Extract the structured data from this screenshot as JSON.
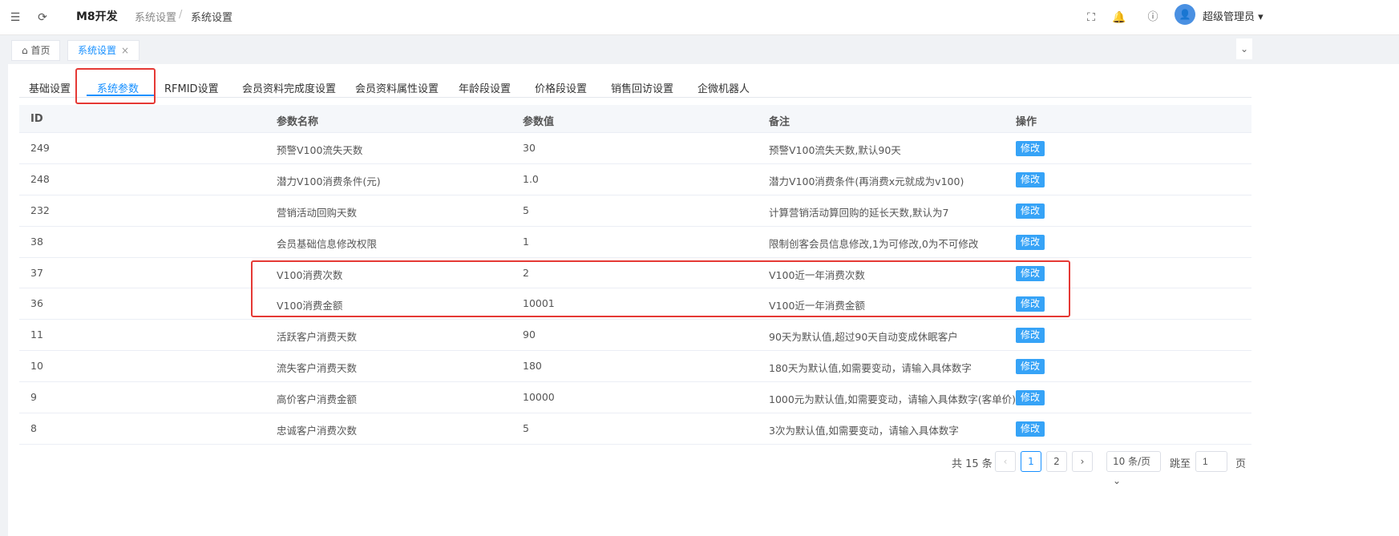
{
  "header": {
    "app_title": "M8开发",
    "breadcrumb": [
      "系统设置",
      "系统设置"
    ],
    "breadcrumb_sep": "/",
    "user_name": "超级管理员"
  },
  "tabs": [
    {
      "label": "首页",
      "icon": "home-icon"
    },
    {
      "label": "系统设置",
      "close": "×"
    }
  ],
  "subtabs": [
    "基础设置",
    "系统参数",
    "RFMID设置",
    "会员资料完成度设置",
    "会员资料属性设置",
    "年龄段设置",
    "价格段设置",
    "销售回访设置",
    "企微机器人"
  ],
  "active_subtab": "系统参数",
  "table": {
    "headers": [
      "ID",
      "参数名称",
      "参数值",
      "备注",
      "操作"
    ],
    "edit_label": "修改",
    "rows": [
      {
        "id": "249",
        "name": "预警V100流失天数",
        "value": "30",
        "note": "预警V100流失天数,默认90天"
      },
      {
        "id": "248",
        "name": "潜力V100消费条件(元)",
        "value": "1.0",
        "note": "潜力V100消费条件(再消费x元就成为v100)"
      },
      {
        "id": "232",
        "name": "营销活动回购天数",
        "value": "5",
        "note": "计算营销活动算回购的延长天数,默认为7"
      },
      {
        "id": "38",
        "name": "会员基础信息修改权限",
        "value": "1",
        "note": "限制创客会员信息修改,1为可修改,0为不可修改"
      },
      {
        "id": "37",
        "name": "V100消费次数",
        "value": "2",
        "note": "V100近一年消费次数"
      },
      {
        "id": "36",
        "name": "V100消费金额",
        "value": "10001",
        "note": "V100近一年消费金额"
      },
      {
        "id": "11",
        "name": "活跃客户消费天数",
        "value": "90",
        "note": "90天为默认值,超过90天自动变成休眠客户"
      },
      {
        "id": "10",
        "name": "流失客户消费天数",
        "value": "180",
        "note": "180天为默认值,如需要变动，请输入具体数字"
      },
      {
        "id": "9",
        "name": "高价客户消费金额",
        "value": "10000",
        "note": "1000元为默认值,如需要变动，请输入具体数字(客单价)"
      },
      {
        "id": "8",
        "name": "忠诚客户消费次数",
        "value": "5",
        "note": "3次为默认值,如需要变动，请输入具体数字"
      }
    ]
  },
  "pagination": {
    "total": "共 15 条",
    "prev": "‹",
    "pages": [
      "1",
      "2"
    ],
    "current_page": "1",
    "next": "›",
    "page_size": "10 条/页",
    "jump_label": "跳至",
    "jump_value": "1",
    "page_suffix": "页"
  }
}
